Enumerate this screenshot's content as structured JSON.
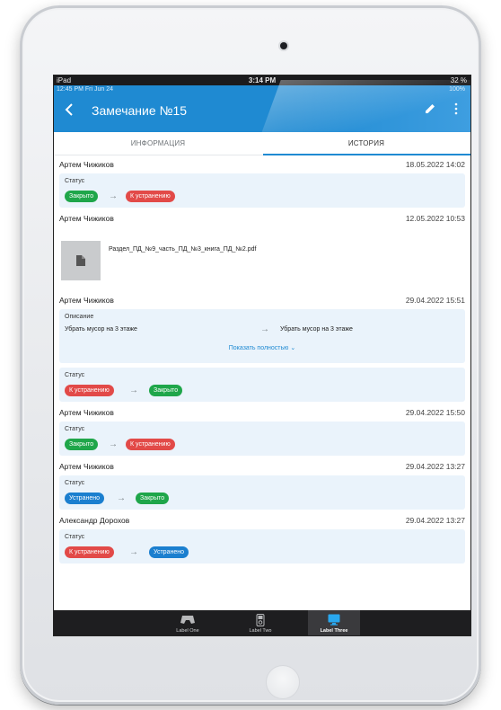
{
  "system_status": {
    "device": "iPad",
    "time": "3:14 PM",
    "battery": "32 %"
  },
  "app_status": {
    "datetime": "12:45 PM  Fri Jun 24",
    "battery": "100%"
  },
  "appbar": {
    "title": "Замечание №15"
  },
  "tabs": [
    {
      "label": "ИНФОРМАЦИЯ",
      "active": false
    },
    {
      "label": "ИСТОРИЯ",
      "active": true
    }
  ],
  "entries": [
    {
      "author": "Артем Чижиков",
      "date": "18.05.2022 14:02",
      "label": "Статус",
      "from": "Закрыто",
      "to": "К устранению"
    },
    {
      "author": "Артем Чижиков",
      "date": "12.05.2022 10:53",
      "file": "Раздел_ПД_№9_часть_ПД_№3_книга_ПД_№2.pdf"
    },
    {
      "author": "Артем Чижиков",
      "date": "29.04.2022 15:51",
      "description": {
        "label": "Описание",
        "from": "Убрать мусор на 3 этаже",
        "to": "Убрать мусор на 3 этаже",
        "show_more": "Показать полностью"
      },
      "label": "Статус",
      "from": "К устранению",
      "to": "Закрыто"
    },
    {
      "author": "Артем Чижиков",
      "date": "29.04.2022 15:50",
      "label": "Статус",
      "from": "Закрыто",
      "to": "К устранению"
    },
    {
      "author": "Артем Чижиков",
      "date": "29.04.2022 13:27",
      "label": "Статус",
      "from": "Устранено",
      "to": "Закрыто"
    },
    {
      "author": "Александр Дорохов",
      "date": "29.04.2022 13:27",
      "label": "Статус",
      "from": "К устранению",
      "to": "Устранено"
    }
  ],
  "status_colors": {
    "Закрыто": "#1fa64a",
    "К устранению": "#e24a48",
    "Устранено": "#1b7fcf"
  },
  "bottom_tabs": [
    {
      "label": "Label One",
      "icon": "gamepad-icon",
      "active": false
    },
    {
      "label": "Label Two",
      "icon": "ipod-icon",
      "active": false
    },
    {
      "label": "Label Three",
      "icon": "monitor-icon",
      "active": true
    }
  ],
  "colors": {
    "accent": "#1f8ad2",
    "card_background": "#eaf3fb"
  }
}
